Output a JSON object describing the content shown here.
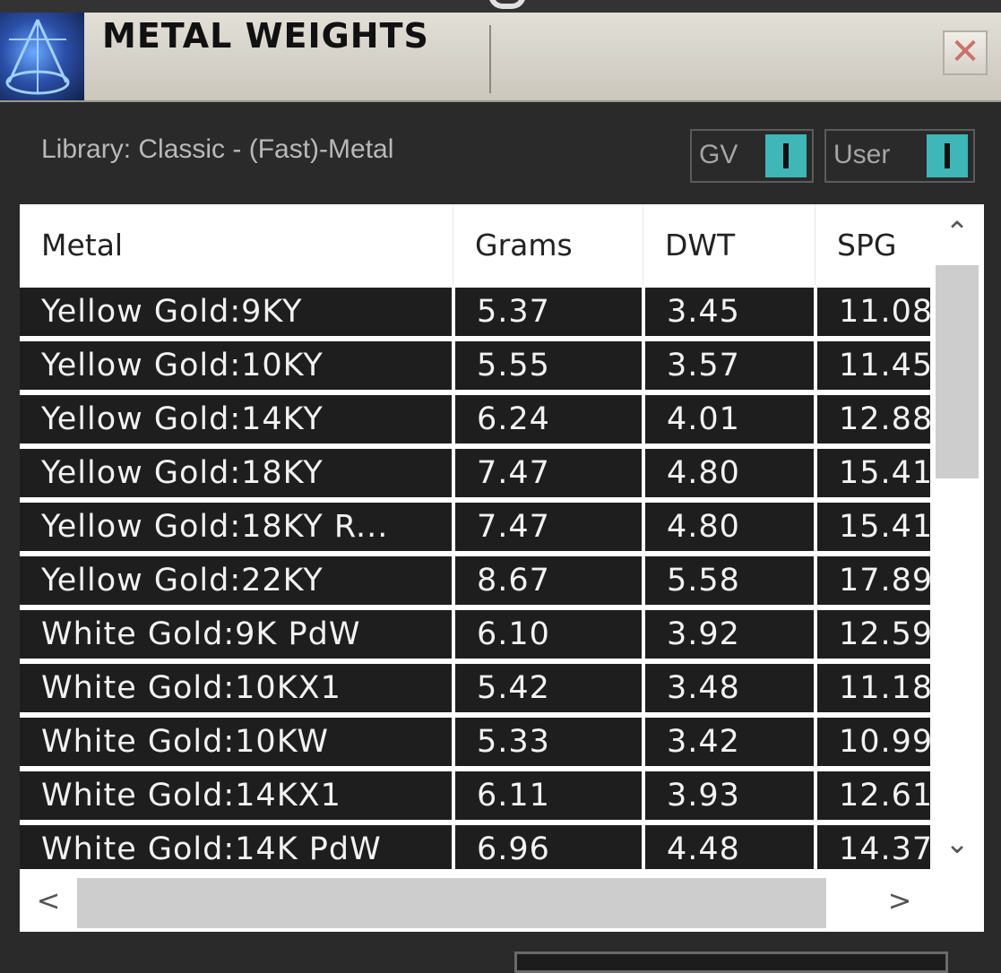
{
  "window": {
    "title": "METAL WEIGHTS",
    "close_label": "✕"
  },
  "library_label": "Library: Classic - (Fast)-Metal",
  "toggles": {
    "gv_label": "GV",
    "user_label": "User"
  },
  "table": {
    "columns": [
      "Metal",
      "Grams",
      "DWT",
      "SPG"
    ],
    "rows": [
      {
        "metal": "Yellow Gold:9KY",
        "grams": "5.37",
        "dwt": "3.45",
        "spg": "11.08"
      },
      {
        "metal": "Yellow Gold:10KY",
        "grams": "5.55",
        "dwt": "3.57",
        "spg": "11.45"
      },
      {
        "metal": "Yellow Gold:14KY",
        "grams": "6.24",
        "dwt": "4.01",
        "spg": "12.88"
      },
      {
        "metal": "Yellow Gold:18KY",
        "grams": "7.47",
        "dwt": "4.80",
        "spg": "15.41"
      },
      {
        "metal": "Yellow Gold:18KY R...",
        "grams": "7.47",
        "dwt": "4.80",
        "spg": "15.41"
      },
      {
        "metal": "Yellow Gold:22KY",
        "grams": "8.67",
        "dwt": "5.58",
        "spg": "17.89"
      },
      {
        "metal": "White Gold:9K PdW",
        "grams": "6.10",
        "dwt": "3.92",
        "spg": "12.59"
      },
      {
        "metal": "White Gold:10KX1",
        "grams": "5.42",
        "dwt": "3.48",
        "spg": "11.18"
      },
      {
        "metal": "White Gold:10KW",
        "grams": "5.33",
        "dwt": "3.42",
        "spg": "10.99"
      },
      {
        "metal": "White Gold:14KX1",
        "grams": "6.11",
        "dwt": "3.93",
        "spg": "12.61"
      },
      {
        "metal": "White Gold:14K PdW",
        "grams": "6.96",
        "dwt": "4.48",
        "spg": "14.37"
      }
    ]
  },
  "scrollbar": {
    "up_arrow": "⌃",
    "down_arrow": "⌄",
    "left_arrow": "<",
    "right_arrow": ">"
  },
  "colors": {
    "toggle_on": "#3fb6b8",
    "row_background": "#1e1e1e",
    "title_bar": "#d8d4cb"
  },
  "icons": {
    "app_logo": "scale-icon"
  }
}
